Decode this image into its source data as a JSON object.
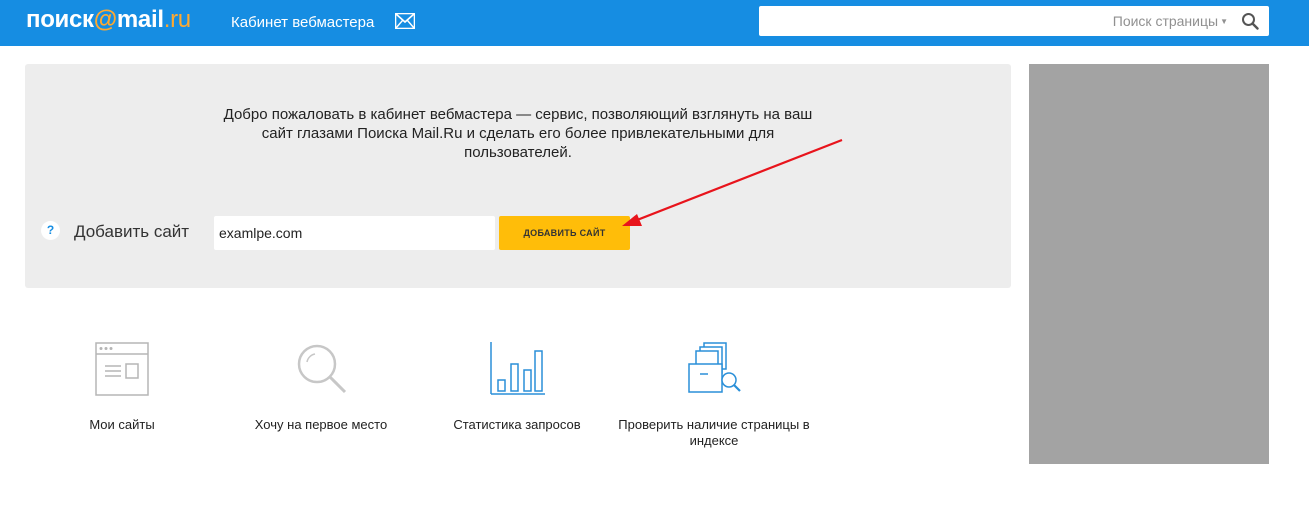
{
  "header": {
    "logo": {
      "part1": "поиск",
      "at": "@",
      "part2": "mail",
      "dot": ".",
      "ru": "ru"
    },
    "cabinet_link": "Кабинет вебмастера",
    "mail_icon": "envelope-icon",
    "search": {
      "value": "",
      "scope_label": "Поиск страницы",
      "button_icon": "search-icon"
    }
  },
  "welcome": {
    "text": "Добро пожаловать в кабинет вебмастера — сервис, позволяющий взглянуть на ваш сайт глазами Поиска Mail.Ru и сделать его более привлекательными для пользователей.",
    "help_symbol": "?",
    "add_label": "Добавить сайт",
    "site_input_value": "examlpe.com",
    "add_button": "ДОБАВИТЬ САЙТ"
  },
  "features": [
    {
      "label": "Мои сайты",
      "icon": "browser-window-icon"
    },
    {
      "label": "Хочу на первое место",
      "icon": "magnifier-icon"
    },
    {
      "label": "Статистика запросов",
      "icon": "bar-chart-icon"
    },
    {
      "label": "Проверить наличие страницы в индексе",
      "icon": "documents-search-icon"
    }
  ],
  "colors": {
    "header_bg": "#168de2",
    "accent": "#ffbd09",
    "logo_accent": "#ffa930",
    "panel_bg": "#ededed",
    "side_block": "#a3a3a3",
    "arrow": "#e8141c",
    "icon_gray": "#b5b5b5",
    "icon_blue": "#2a8fd8"
  }
}
